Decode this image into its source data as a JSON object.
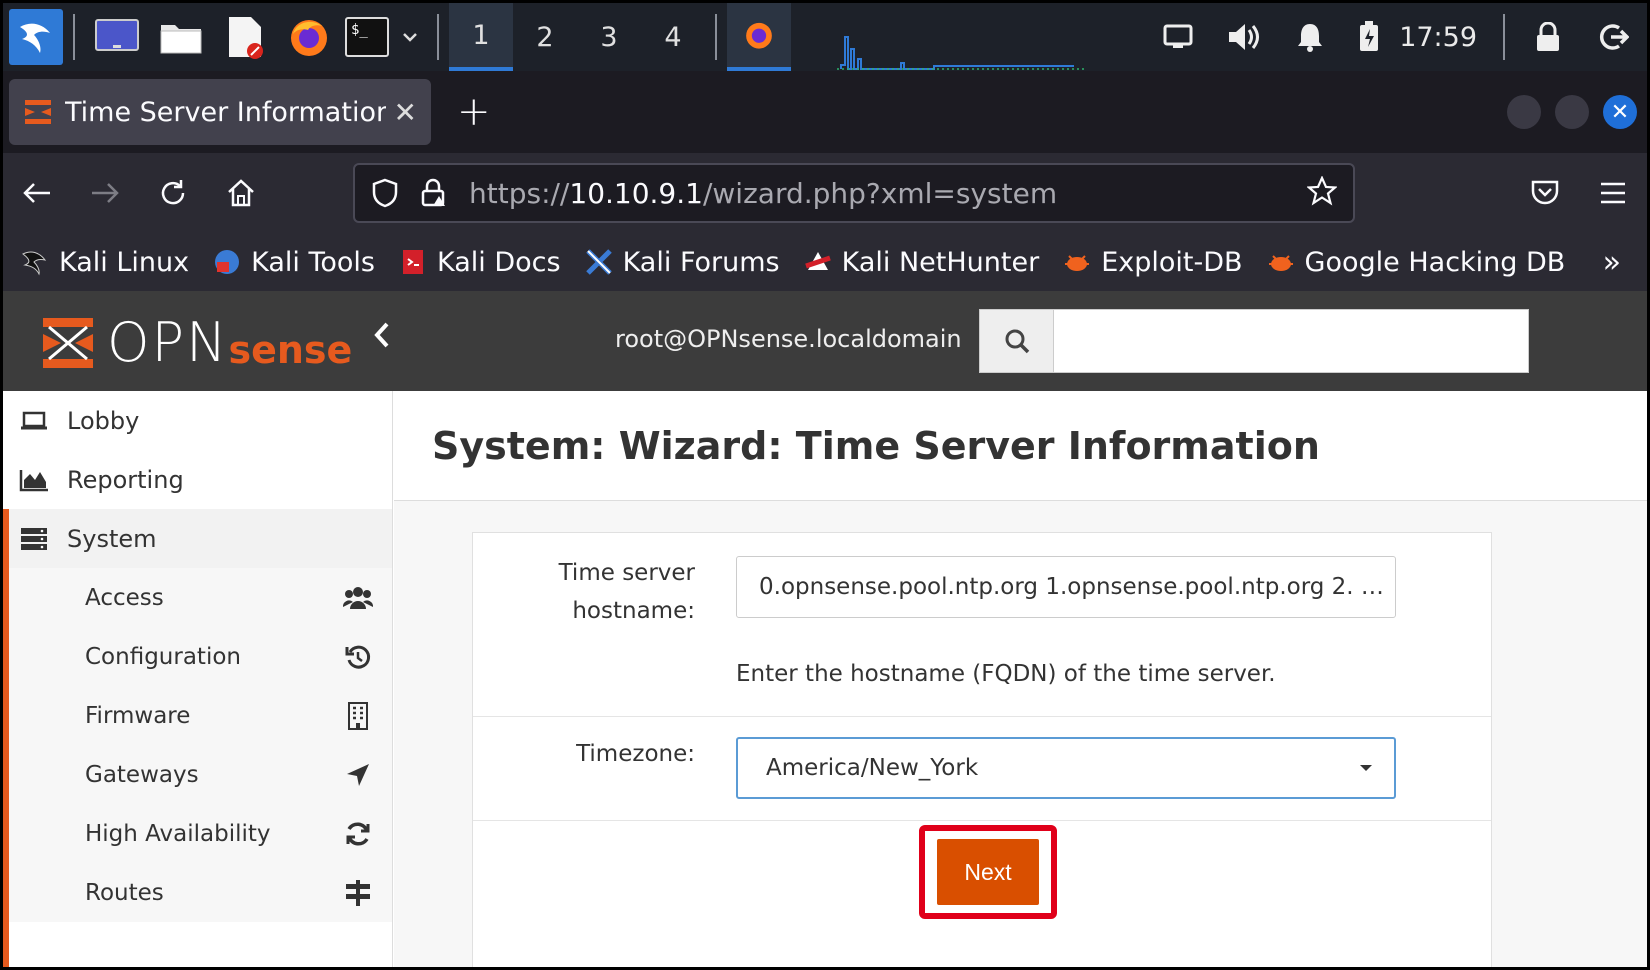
{
  "taskbar": {
    "workspaces": [
      "1",
      "2",
      "3",
      "4"
    ],
    "clock": "17:59"
  },
  "browser": {
    "tab_title": "Time Server Information |",
    "url_scheme": "https://",
    "url_host": "10.10.9.1",
    "url_path": "/wizard.php?xml=system"
  },
  "bookmarks": [
    {
      "label": "Kali Linux",
      "icon": "kali-dragon-icon"
    },
    {
      "label": "Kali Tools",
      "icon": "kali-tools-icon"
    },
    {
      "label": "Kali Docs",
      "icon": "kali-docs-icon"
    },
    {
      "label": "Kali Forums",
      "icon": "kali-forums-icon"
    },
    {
      "label": "Kali NetHunter",
      "icon": "nethunter-icon"
    },
    {
      "label": "Exploit-DB",
      "icon": "exploit-db-icon"
    },
    {
      "label": "Google Hacking DB",
      "icon": "ghdb-icon"
    }
  ],
  "opnsense": {
    "logo_opn": "OPN",
    "logo_sense": "sense",
    "user": "root@OPNsense.localdomain",
    "search_value": ""
  },
  "sidebar": {
    "lobby": "Lobby",
    "reporting": "Reporting",
    "system": "System",
    "sub_items": [
      {
        "label": "Access",
        "icon": "users-icon"
      },
      {
        "label": "Configuration",
        "icon": "history-icon"
      },
      {
        "label": "Firmware",
        "icon": "building-icon"
      },
      {
        "label": "Gateways",
        "icon": "location-arrow-icon"
      },
      {
        "label": "High Availability",
        "icon": "refresh-icon"
      },
      {
        "label": "Routes",
        "icon": "signpost-icon"
      }
    ]
  },
  "page": {
    "title": "System: Wizard: Time Server Information",
    "time_server_label_1": "Time server",
    "time_server_label_2": "hostname:",
    "time_server_value": "0.opnsense.pool.ntp.org 1.opnsense.pool.ntp.org 2. …",
    "time_server_help": "Enter the hostname (FQDN) of the time server.",
    "timezone_label": "Timezone:",
    "timezone_value": "America/New_York",
    "next_label": "Next"
  },
  "colors": {
    "accent": "#e65a1e",
    "next_button": "#d94f00",
    "highlight": "#e0001a",
    "focus": "#5b9bd5"
  }
}
